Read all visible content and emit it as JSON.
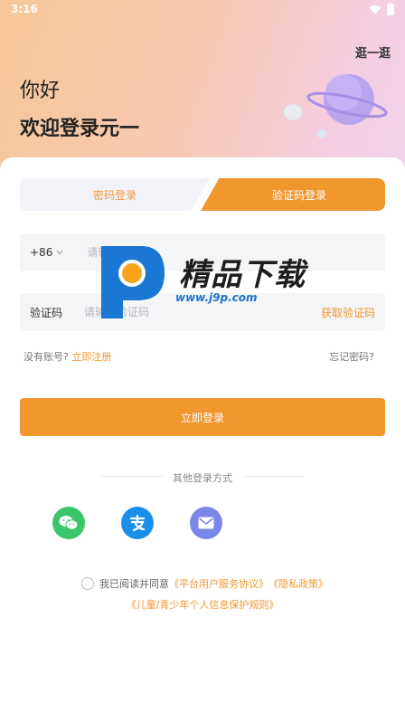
{
  "status_bar": {
    "time": "3:16"
  },
  "header": {
    "browse": "逛一逛",
    "greeting": "你好",
    "welcome": "欢迎登录元一"
  },
  "tabs": {
    "password_login": "密码登录",
    "code_login": "验证码登录",
    "active": "code_login"
  },
  "phone": {
    "country_code": "+86",
    "placeholder": "请输入手机号"
  },
  "code": {
    "label": "验证码",
    "placeholder": "请输入验证码",
    "get_code": "获取验证码"
  },
  "links": {
    "no_account": "没有账号?",
    "register": "立即注册",
    "forgot": "忘记密码?"
  },
  "login_button": "立即登录",
  "other_login": {
    "title": "其他登录方式",
    "methods": [
      "wechat-icon",
      "alipay-icon",
      "mail-icon"
    ]
  },
  "agreement": {
    "prefix": "我已阅读并同意",
    "service": "《平台用户服务协议》",
    "privacy": "《隐私政策》",
    "minor": "《儿童/青少年个人信息保护规则》"
  },
  "watermark": {
    "brand": "精品下载",
    "url": "www.j9p.com"
  },
  "colors": {
    "accent": "#f2962e",
    "wechat": "#3bc56a",
    "alipay": "#1b8fe8",
    "mail": "#7b86ea"
  }
}
